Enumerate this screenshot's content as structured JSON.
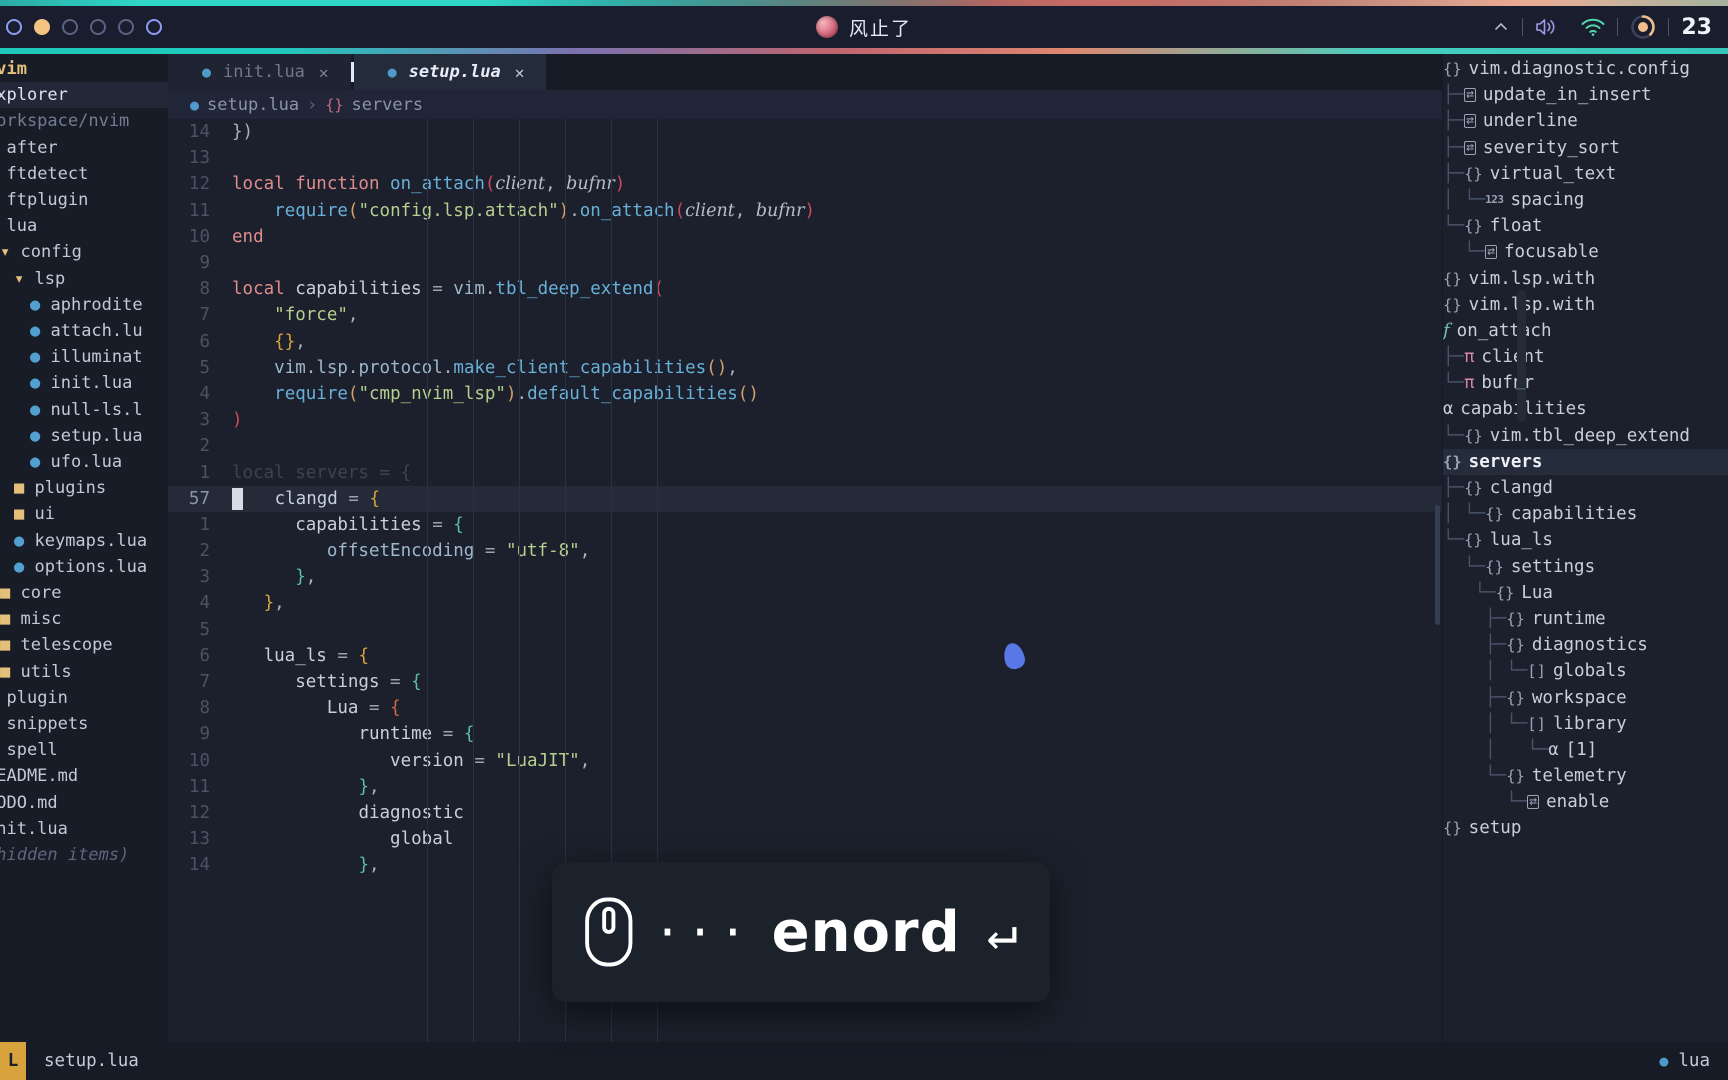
{
  "topbar": {
    "workspaces": [
      {
        "name": "workspace-1",
        "state": "active"
      },
      {
        "name": "workspace-2",
        "state": "filled"
      },
      {
        "name": "workspace-3",
        "state": "idle"
      },
      {
        "name": "workspace-4",
        "state": "idle"
      },
      {
        "name": "workspace-5",
        "state": "idle"
      },
      {
        "name": "workspace-6",
        "state": "active"
      }
    ],
    "title": "风止了",
    "chevron": "⌃",
    "clock": "23"
  },
  "explorer": {
    "root": "nvim",
    "title": "Explorer",
    "path": "Workspace/nvim",
    "items": [
      {
        "label": "after",
        "indent": 0,
        "type": "folder"
      },
      {
        "label": "ftdetect",
        "indent": 0,
        "type": "folder"
      },
      {
        "label": "ftplugin",
        "indent": 0,
        "type": "folder"
      },
      {
        "label": "lua",
        "indent": 0,
        "type": "folder"
      },
      {
        "label": "config",
        "indent": 1,
        "type": "folder-open"
      },
      {
        "label": "lsp",
        "indent": 2,
        "type": "folder-open"
      },
      {
        "label": "aphrodite",
        "indent": 3,
        "type": "lua"
      },
      {
        "label": "attach.lu",
        "indent": 3,
        "type": "lua"
      },
      {
        "label": "illuminat",
        "indent": 3,
        "type": "lua"
      },
      {
        "label": "init.lua",
        "indent": 3,
        "type": "lua"
      },
      {
        "label": "null-ls.l",
        "indent": 3,
        "type": "lua"
      },
      {
        "label": "setup.lua",
        "indent": 3,
        "type": "lua"
      },
      {
        "label": "ufo.lua",
        "indent": 3,
        "type": "lua"
      },
      {
        "label": "plugins",
        "indent": 2,
        "type": "folder"
      },
      {
        "label": "ui",
        "indent": 2,
        "type": "folder"
      },
      {
        "label": "keymaps.lua",
        "indent": 2,
        "type": "lua"
      },
      {
        "label": "options.lua",
        "indent": 2,
        "type": "lua"
      },
      {
        "label": "core",
        "indent": 1,
        "type": "folder"
      },
      {
        "label": "misc",
        "indent": 1,
        "type": "folder"
      },
      {
        "label": "telescope",
        "indent": 1,
        "type": "folder"
      },
      {
        "label": "utils",
        "indent": 1,
        "type": "folder"
      },
      {
        "label": "plugin",
        "indent": 0,
        "type": "folder"
      },
      {
        "label": "snippets",
        "indent": 0,
        "type": "folder"
      },
      {
        "label": "spell",
        "indent": 0,
        "type": "folder"
      },
      {
        "label": "README.md",
        "indent": 0,
        "type": "file"
      },
      {
        "label": "TODO.md",
        "indent": 0,
        "type": "file"
      },
      {
        "label": "init.lua",
        "indent": 0,
        "type": "file"
      }
    ],
    "hidden_note": "(hidden items)"
  },
  "tabs": [
    {
      "label": "init.lua",
      "icon": "lua-icon",
      "close": "✕",
      "active": false
    },
    {
      "label": "setup.lua",
      "icon": "lua-icon",
      "close": "✕",
      "active": true
    }
  ],
  "breadcrumb": {
    "file": "setup.lua",
    "separator": "›",
    "kind_icon": "{}",
    "symbol": "servers"
  },
  "code": {
    "lines": [
      {
        "num": "14",
        "tokens": [
          [
            "pun",
            "})"
          ]
        ]
      },
      {
        "num": "13",
        "tokens": []
      },
      {
        "num": "12",
        "tokens": [
          [
            "kw",
            "local "
          ],
          [
            "kw",
            "function "
          ],
          [
            "fn",
            "on_attach"
          ],
          [
            "red",
            "("
          ],
          [
            "par",
            "client"
          ],
          [
            "pun",
            ", "
          ],
          [
            "par",
            "bufnr"
          ],
          [
            "red",
            ")"
          ]
        ]
      },
      {
        "num": "11",
        "tokens": [
          [
            "pad",
            "    "
          ],
          [
            "fn",
            "require"
          ],
          [
            "num",
            "("
          ],
          [
            "str",
            "\"config.lsp.attach\""
          ],
          [
            "num",
            ")"
          ],
          [
            "pun",
            "."
          ],
          [
            "fn",
            "on_attach"
          ],
          [
            "red",
            "("
          ],
          [
            "par",
            "client"
          ],
          [
            "pun",
            ", "
          ],
          [
            "par",
            "bufnr"
          ],
          [
            "red",
            ")"
          ]
        ]
      },
      {
        "num": "10",
        "tokens": [
          [
            "kw",
            "end"
          ]
        ]
      },
      {
        "num": "9",
        "tokens": []
      },
      {
        "num": "8",
        "tokens": [
          [
            "kw",
            "local "
          ],
          [
            "id",
            "capabilities "
          ],
          [
            "op",
            "= "
          ],
          [
            "prop",
            "vim"
          ],
          [
            "pun",
            "."
          ],
          [
            "fn",
            "tbl_deep_extend"
          ],
          [
            "red",
            "("
          ]
        ]
      },
      {
        "num": "7",
        "tokens": [
          [
            "pad",
            "    "
          ],
          [
            "str",
            "\"force\""
          ],
          [
            "pun",
            ","
          ]
        ]
      },
      {
        "num": "6",
        "tokens": [
          [
            "pad",
            "    "
          ],
          [
            "yel",
            "{}"
          ],
          [
            "pun",
            ","
          ]
        ]
      },
      {
        "num": "5",
        "tokens": [
          [
            "pad",
            "    "
          ],
          [
            "prop",
            "vim"
          ],
          [
            "pun",
            "."
          ],
          [
            "prop",
            "lsp"
          ],
          [
            "pun",
            "."
          ],
          [
            "prop",
            "protocol"
          ],
          [
            "pun",
            "."
          ],
          [
            "fn",
            "make_client_capabilities"
          ],
          [
            "num",
            "()"
          ],
          [
            "pun",
            ","
          ]
        ]
      },
      {
        "num": "4",
        "tokens": [
          [
            "pad",
            "    "
          ],
          [
            "fn",
            "require"
          ],
          [
            "num",
            "("
          ],
          [
            "str",
            "\"cmp_nvim_lsp\""
          ],
          [
            "num",
            ")"
          ],
          [
            "pun",
            "."
          ],
          [
            "fn",
            "default_capabilities"
          ],
          [
            "num",
            "()"
          ]
        ]
      },
      {
        "num": "3",
        "tokens": [
          [
            "red",
            ")"
          ]
        ]
      },
      {
        "num": "2",
        "tokens": []
      },
      {
        "num": "1",
        "tokens": [
          [
            "dim",
            "local servers = {"
          ]
        ]
      },
      {
        "num": "57",
        "cursor": true,
        "tokens": [
          [
            "pad",
            "   "
          ],
          [
            "id",
            "clangd "
          ],
          [
            "op",
            "= "
          ],
          [
            "yel",
            "{"
          ]
        ]
      },
      {
        "num": "1",
        "tokens": [
          [
            "pad",
            "      "
          ],
          [
            "id",
            "capabilities "
          ],
          [
            "op",
            "= "
          ],
          [
            "grn",
            "{"
          ]
        ]
      },
      {
        "num": "2",
        "tokens": [
          [
            "pad",
            "         "
          ],
          [
            "prop",
            "offsetEncoding "
          ],
          [
            "op",
            "= "
          ],
          [
            "str",
            "\"utf-8\""
          ],
          [
            "pun",
            ","
          ]
        ]
      },
      {
        "num": "3",
        "tokens": [
          [
            "pad",
            "      "
          ],
          [
            "grn",
            "}"
          ],
          [
            "pun",
            ","
          ]
        ]
      },
      {
        "num": "4",
        "tokens": [
          [
            "pad",
            "   "
          ],
          [
            "yel",
            "}"
          ],
          [
            "pun",
            ","
          ]
        ]
      },
      {
        "num": "5",
        "tokens": []
      },
      {
        "num": "6",
        "tokens": [
          [
            "pad",
            "   "
          ],
          [
            "id",
            "lua_ls "
          ],
          [
            "op",
            "= "
          ],
          [
            "yel",
            "{"
          ]
        ]
      },
      {
        "num": "7",
        "tokens": [
          [
            "pad",
            "      "
          ],
          [
            "id",
            "settings "
          ],
          [
            "op",
            "= "
          ],
          [
            "grn",
            "{"
          ]
        ]
      },
      {
        "num": "8",
        "tokens": [
          [
            "pad",
            "         "
          ],
          [
            "id",
            "Lua "
          ],
          [
            "op",
            "= "
          ],
          [
            "org",
            "{"
          ]
        ]
      },
      {
        "num": "9",
        "tokens": [
          [
            "pad",
            "            "
          ],
          [
            "id",
            "runtime "
          ],
          [
            "op",
            "= "
          ],
          [
            "grn",
            "{"
          ]
        ]
      },
      {
        "num": "10",
        "tokens": [
          [
            "pad",
            "               "
          ],
          [
            "id",
            "version "
          ],
          [
            "op",
            "= "
          ],
          [
            "str",
            "\"LuaJIT\""
          ],
          [
            "pun",
            ","
          ]
        ]
      },
      {
        "num": "11",
        "tokens": [
          [
            "pad",
            "            "
          ],
          [
            "grn",
            "}"
          ],
          [
            "pun",
            ","
          ]
        ]
      },
      {
        "num": "12",
        "tokens": [
          [
            "pad",
            "            "
          ],
          [
            "id",
            "diagnostic"
          ]
        ]
      },
      {
        "num": "13",
        "tokens": [
          [
            "pad",
            "               "
          ],
          [
            "id",
            "global"
          ]
        ]
      },
      {
        "num": "14",
        "tokens": [
          [
            "pad",
            "            "
          ],
          [
            "grn",
            "}"
          ],
          [
            "pun",
            ","
          ]
        ]
      }
    ]
  },
  "outline": {
    "items": [
      {
        "label": "vim.diagnostic.config",
        "kind": "obj",
        "indent": 0,
        "guide": ""
      },
      {
        "label": "update_in_insert",
        "kind": "bool",
        "indent": 1,
        "guide": "├─"
      },
      {
        "label": "underline",
        "kind": "bool",
        "indent": 1,
        "guide": "├─"
      },
      {
        "label": "severity_sort",
        "kind": "bool",
        "indent": 1,
        "guide": "├─"
      },
      {
        "label": "virtual_text",
        "kind": "obj",
        "indent": 1,
        "guide": "├─"
      },
      {
        "label": "spacing",
        "kind": "num",
        "indent": 2,
        "guide": "│ └─"
      },
      {
        "label": "float",
        "kind": "obj",
        "indent": 1,
        "guide": "└─"
      },
      {
        "label": "focusable",
        "kind": "bool",
        "indent": 2,
        "guide": "  └─"
      },
      {
        "label": "vim.lsp.with",
        "kind": "obj",
        "indent": 0,
        "guide": ""
      },
      {
        "label": "vim.lsp.with",
        "kind": "obj",
        "indent": 0,
        "guide": ""
      },
      {
        "label": "on_attach",
        "kind": "fn",
        "indent": 0,
        "guide": ""
      },
      {
        "label": "client",
        "kind": "par",
        "indent": 1,
        "guide": "├─"
      },
      {
        "label": "bufnr",
        "kind": "par",
        "indent": 1,
        "guide": "└─"
      },
      {
        "label": "capabilities",
        "kind": "arr",
        "indent": 0,
        "guide": ""
      },
      {
        "label": "vim.tbl_deep_extend",
        "kind": "obj",
        "indent": 1,
        "guide": "└─"
      },
      {
        "label": "servers",
        "kind": "obj",
        "indent": 0,
        "guide": "",
        "selected": true
      },
      {
        "label": "clangd",
        "kind": "obj",
        "indent": 1,
        "guide": "├─"
      },
      {
        "label": "capabilities",
        "kind": "obj",
        "indent": 2,
        "guide": "│ └─"
      },
      {
        "label": "lua_ls",
        "kind": "obj",
        "indent": 1,
        "guide": "└─"
      },
      {
        "label": "settings",
        "kind": "obj",
        "indent": 2,
        "guide": "  └─"
      },
      {
        "label": "Lua",
        "kind": "obj",
        "indent": 3,
        "guide": "   └─"
      },
      {
        "label": "runtime",
        "kind": "obj",
        "indent": 4,
        "guide": "    ├─"
      },
      {
        "label": "diagnostics",
        "kind": "obj",
        "indent": 4,
        "guide": "    ├─"
      },
      {
        "label": "globals",
        "kind": "lst",
        "indent": 5,
        "guide": "    │ └─"
      },
      {
        "label": "workspace",
        "kind": "obj",
        "indent": 4,
        "guide": "    ├─"
      },
      {
        "label": "library",
        "kind": "lst",
        "indent": 5,
        "guide": "    │ └─"
      },
      {
        "label": "[1]",
        "kind": "arr",
        "indent": 6,
        "guide": "    │   └─"
      },
      {
        "label": "telemetry",
        "kind": "obj",
        "indent": 4,
        "guide": "    └─"
      },
      {
        "label": "enable",
        "kind": "bool",
        "indent": 5,
        "guide": "      └─"
      },
      {
        "label": "setup",
        "kind": "obj",
        "indent": 0,
        "guide": ""
      }
    ]
  },
  "statusline": {
    "mode": "L",
    "file": "setup.lua",
    "language": "lua",
    "lang_icon": "lua-icon"
  },
  "keycast": {
    "mouse_icon": "mouse-icon",
    "dots": "···",
    "keys": "enord",
    "enter_icon": "↵"
  },
  "colors": {
    "accent_blue": "#5878e8",
    "mode_yellow": "#d8a33d",
    "lua_blue": "#4f9acb",
    "string_green": "#b5cf8e",
    "keyword_red": "#e08c8c"
  }
}
